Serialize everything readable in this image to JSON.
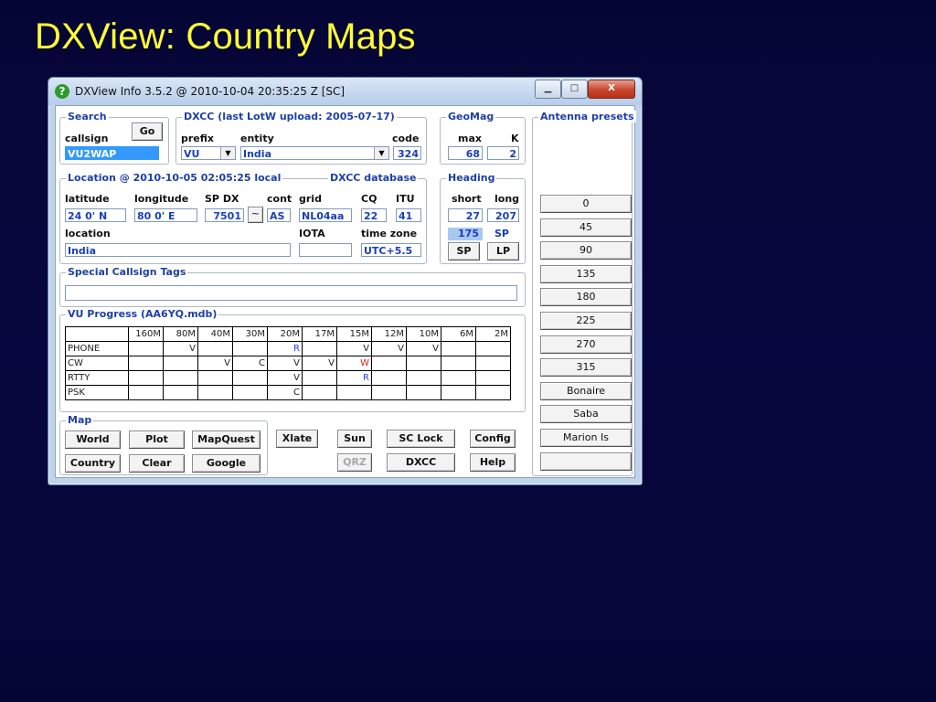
{
  "slide": {
    "title": "DXView: Country Maps"
  },
  "window": {
    "title": "DXView Info 3.5.2 @ 2010-10-04  20:35:25 Z  [SC]",
    "minimize": "▁",
    "maximize": "□",
    "close": "X"
  },
  "search": {
    "legend": "Search",
    "callsign_label": "callsign",
    "callsign_value": "VU2WAP",
    "go_label": "Go"
  },
  "dxcc": {
    "legend": "DXCC  (last LotW upload: 2005-07-17)",
    "prefix_label": "prefix",
    "entity_label": "entity",
    "code_label": "code",
    "prefix_value": "VU",
    "entity_value": "India",
    "code_value": "324"
  },
  "geomag": {
    "legend": "GeoMag",
    "max_label": "max",
    "k_label": "K",
    "max_value": "68",
    "k_value": "2"
  },
  "location": {
    "legend": "Location @ 2010-10-05 02:05:25 local",
    "database_label": "DXCC database",
    "latitude_label": "latitude",
    "longitude_label": "longitude",
    "spdx_label": "SP DX",
    "cont_label": "cont",
    "grid_label": "grid",
    "cq_label": "CQ",
    "itu_label": "ITU",
    "latitude_value": "24  0' N",
    "longitude_value": "80  0' E",
    "spdx_value": "7501",
    "tilde_label": "~",
    "cont_value": "AS",
    "grid_value": "NL04aa",
    "cq_value": "22",
    "itu_value": "41",
    "location_label": "location",
    "location_value": "India",
    "iota_label": "IOTA",
    "iota_value": "",
    "timezone_label": "time zone",
    "timezone_value": "UTC+5.5"
  },
  "heading": {
    "legend": "Heading",
    "short_label": "short",
    "long_label": "long",
    "short_value": "27",
    "long_value": "207",
    "beam_value": "175",
    "beam_mode": "SP",
    "sp_button": "SP",
    "lp_button": "LP"
  },
  "tags": {
    "legend": "Special Callsign Tags",
    "value": ""
  },
  "progress": {
    "legend": "VU Progress (AA6YQ.mdb)",
    "bands": [
      "160M",
      "80M",
      "40M",
      "30M",
      "20M",
      "17M",
      "15M",
      "12M",
      "10M",
      "6M",
      "2M"
    ],
    "rows": [
      {
        "mode": "PHONE",
        "cells": [
          "",
          "V",
          "",
          "",
          "R",
          "",
          "V",
          "V",
          "V",
          "",
          ""
        ]
      },
      {
        "mode": "CW",
        "cells": [
          "",
          "",
          "V",
          "C",
          "V",
          "V",
          "W",
          "",
          "",
          "",
          ""
        ]
      },
      {
        "mode": "RTTY",
        "cells": [
          "",
          "",
          "",
          "",
          "V",
          "",
          "R",
          "",
          "",
          "",
          ""
        ]
      },
      {
        "mode": "PSK",
        "cells": [
          "",
          "",
          "",
          "",
          "C",
          "",
          "",
          "",
          "",
          "",
          ""
        ]
      }
    ],
    "colors": {
      "R": "#2a40ff",
      "W": "#e02020"
    }
  },
  "map": {
    "legend": "Map",
    "world": "World",
    "plot": "Plot",
    "mapquest": "MapQuest",
    "country": "Country",
    "clear": "Clear",
    "google": "Google"
  },
  "actions": {
    "xlate": "Xlate",
    "sun": "Sun",
    "sclock": "SC Lock",
    "config": "Config",
    "qrz": "QRZ",
    "dxcc": "DXCC",
    "help": "Help"
  },
  "antenna": {
    "legend": "Antenna presets",
    "presets": [
      "0",
      "45",
      "90",
      "135",
      "180",
      "225",
      "270",
      "315",
      "Bonaire",
      "Saba",
      "Marion Is",
      ""
    ]
  }
}
